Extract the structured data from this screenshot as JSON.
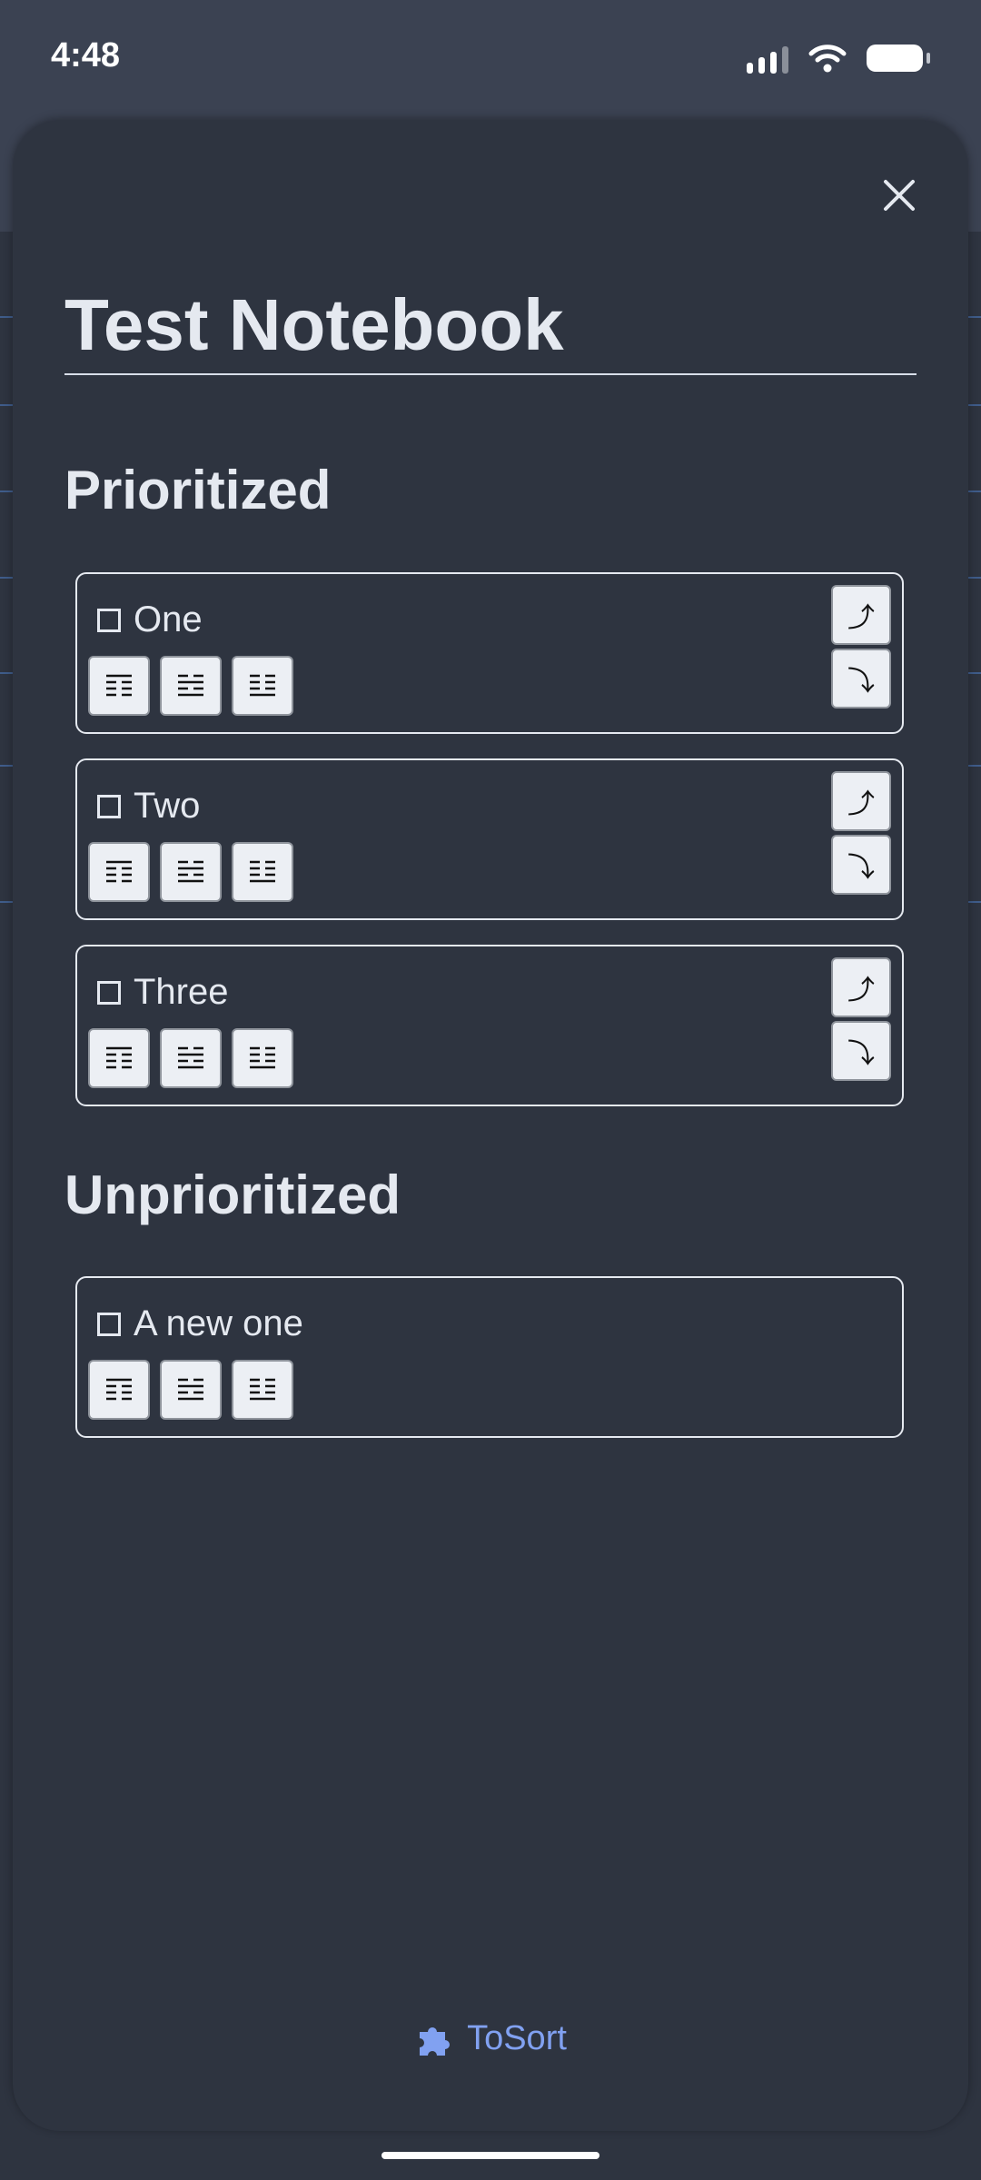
{
  "status": {
    "time": "4:48"
  },
  "notebook": {
    "title": "Test Notebook"
  },
  "sections": {
    "prioritized": "Prioritized",
    "unprioritized": "Unprioritized"
  },
  "prioritized_items": [
    {
      "label": "One"
    },
    {
      "label": "Two"
    },
    {
      "label": "Three"
    }
  ],
  "unprioritized_items": [
    {
      "label": "A new one"
    }
  ],
  "move_buttons": {
    "up": "⤴",
    "down": "⤵"
  },
  "footer": {
    "label": "ToSort",
    "icon": "puzzle-piece-icon",
    "color": "#81a1f1"
  },
  "colors": {
    "background": "#2e3440",
    "text": "#e5e9f0"
  }
}
